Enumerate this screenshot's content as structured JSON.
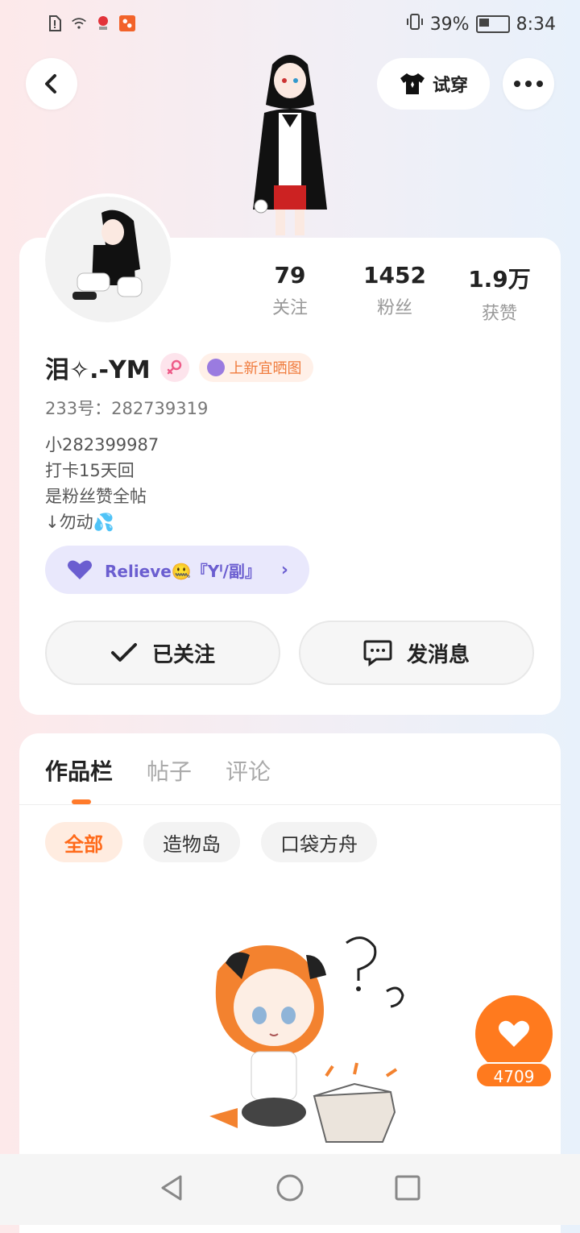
{
  "status_bar": {
    "battery": "39%",
    "time": "8:34"
  },
  "header": {
    "tryon_label": "试穿"
  },
  "stats": [
    {
      "value": "79",
      "label": "关注"
    },
    {
      "value": "1452",
      "label": "粉丝"
    },
    {
      "value": "1.9万",
      "label": "获赞"
    }
  ],
  "profile": {
    "name": "泪✧.-YM",
    "badge_label": "上新宜晒图",
    "uid_label": "233号：",
    "uid": "282739319",
    "bio": [
      "小282399987",
      "打卡15天回",
      "是粉丝赞全帖",
      "↓勿动💦"
    ],
    "group_label": "Relieve🤐『Yˡ/副』"
  },
  "actions": {
    "followed_label": "已关注",
    "message_label": "发消息"
  },
  "tabs": [
    "作品栏",
    "帖子",
    "评论"
  ],
  "filters": [
    "全部",
    "造物岛",
    "口袋方舟"
  ],
  "float": {
    "like_count": "4709"
  },
  "colors": {
    "accent": "#ff7a1e",
    "group_purple": "#6b5ed0"
  }
}
